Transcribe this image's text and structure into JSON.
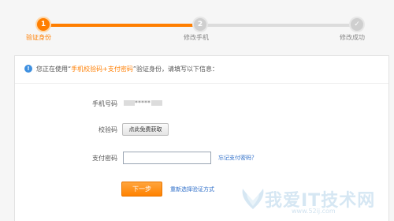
{
  "steps": [
    {
      "number": "1",
      "label": "验证身份",
      "state": "active"
    },
    {
      "number": "2",
      "label": "修改手机",
      "state": "pending"
    },
    {
      "number": "✓",
      "label": "修改成功",
      "state": "pending"
    }
  ],
  "notice": {
    "prefix": "您正在使用“",
    "highlight": "手机校验码+支付密码",
    "suffix": "”验证身份，请填写以下信息："
  },
  "form": {
    "phone_label": "手机号码",
    "phone_value": "*****",
    "code_label": "校验码",
    "code_button": "点此免费获取",
    "pwd_label": "支付密码",
    "pwd_value": "",
    "forgot_link": "忘记支付密码？",
    "next_button": "下一步",
    "reselect_link": "重新选择验证方式"
  },
  "colors": {
    "accent": "#ff7e00",
    "link": "#2f6fc9",
    "info": "#3d8fe0"
  },
  "watermark": {
    "text": "我爱IT技术网",
    "url": "www.52ij.com"
  }
}
